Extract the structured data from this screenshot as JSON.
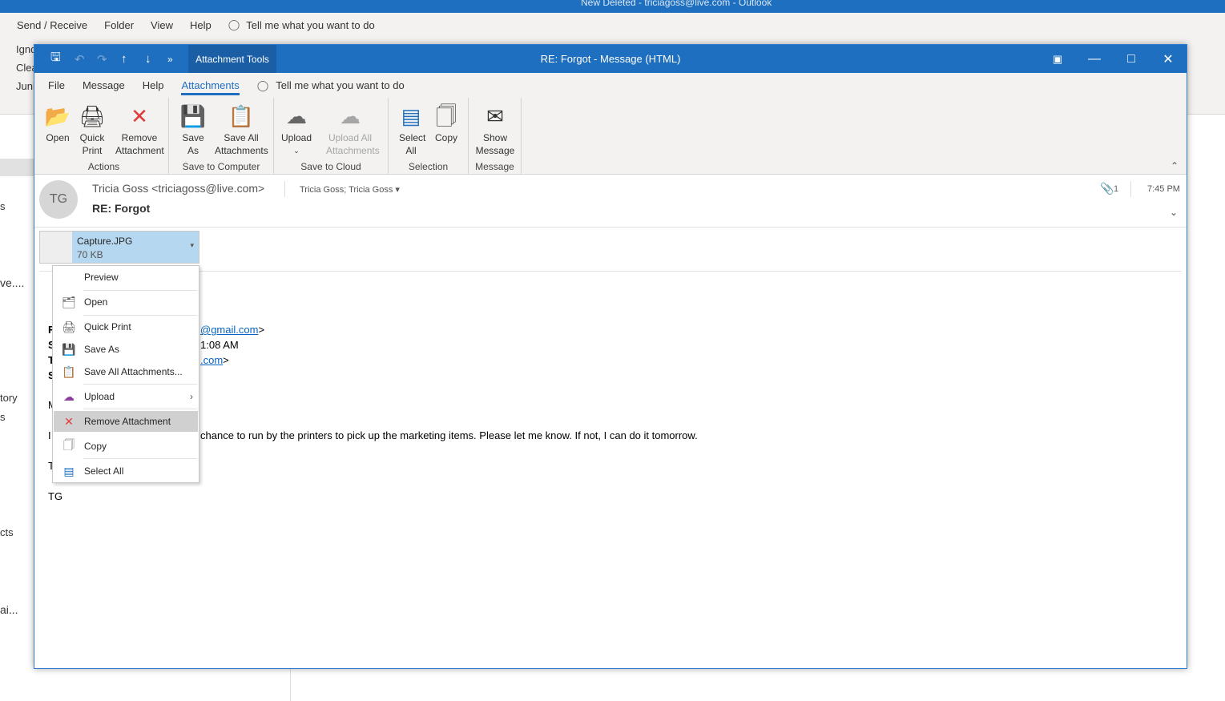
{
  "background_app": {
    "title": "New Deleted - triciagoss@live.com - Outlook",
    "menu": [
      "Send / Receive",
      "Folder",
      "View",
      "Help"
    ],
    "tell_me": "Tell me what you want to do",
    "side_fragments": [
      "Ignc",
      "Clea",
      "Junk",
      "s",
      "ve....",
      "tory",
      "s",
      "cts",
      "ai..."
    ]
  },
  "window": {
    "title": "RE: Forgot  -  Message (HTML)",
    "context_tab": "Attachment Tools",
    "tabs": [
      "File",
      "Message",
      "Help",
      "Attachments"
    ],
    "active_tab": "Attachments",
    "tell_me": "Tell me what you want to do",
    "accent": "#1e6fbf"
  },
  "ribbon": {
    "groups": [
      {
        "label": "Actions",
        "buttons": [
          "Open",
          "Quick Print",
          "Remove Attachment"
        ]
      },
      {
        "label": "Save to Computer",
        "buttons": [
          "Save As",
          "Save All Attachments"
        ]
      },
      {
        "label": "Save to Cloud",
        "buttons": [
          "Upload",
          "Upload All Attachments"
        ]
      },
      {
        "label": "Selection",
        "buttons": [
          "Select All",
          "Copy"
        ]
      },
      {
        "label": "Message",
        "buttons": [
          "Show Message"
        ]
      }
    ]
  },
  "message": {
    "avatar": "TG",
    "sender": "Tricia Goss <triciagoss@live.com>",
    "recipients": "Tricia Goss; Tricia Goss",
    "subject": "RE: Forgot",
    "attachment_count": "1",
    "time": "7:45 PM",
    "attachment": {
      "name": "Capture.JPG",
      "size": "70 KB"
    },
    "body": {
      "from_frag": "@gmail.com",
      "sent_frag": "1:08 AM",
      "to_frag": ".com",
      "line": "chance to run by the printers to pick up the marketing items. Please let me know. If not, I can do it tomorrow.",
      "sig": "TG",
      "initials": [
        "F",
        "S",
        "T",
        "S",
        "M",
        "I",
        "T"
      ]
    }
  },
  "context_menu": {
    "items": [
      {
        "label": "Preview",
        "icon": "none"
      },
      {
        "label": "Open",
        "icon": "folder-open-icon"
      },
      {
        "label": "Quick Print",
        "icon": "printer-icon"
      },
      {
        "label": "Save As",
        "icon": "save-as-icon"
      },
      {
        "label": "Save All Attachments...",
        "icon": "save-all-icon"
      },
      {
        "label": "Upload",
        "icon": "upload-icon"
      },
      {
        "label": "Remove Attachment",
        "icon": "close-icon",
        "highlighted": true
      },
      {
        "label": "Copy",
        "icon": "copy-icon"
      },
      {
        "label": "Select All",
        "icon": "select-all-icon"
      }
    ]
  }
}
